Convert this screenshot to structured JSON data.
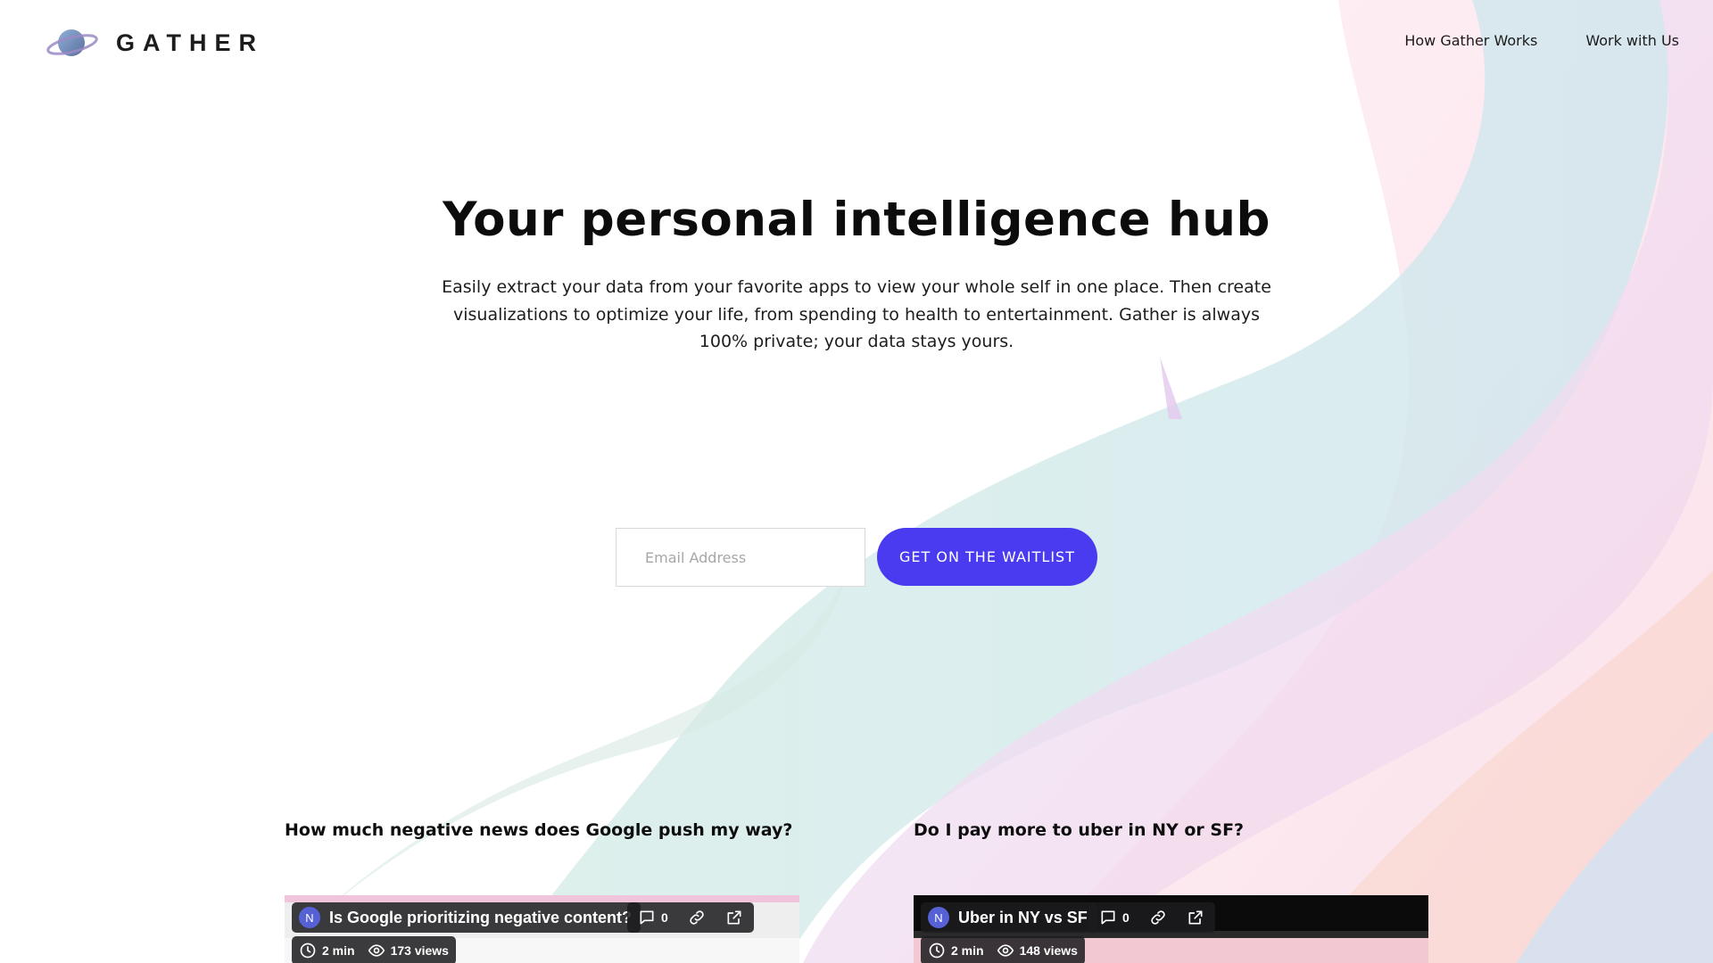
{
  "brand": {
    "name": "GATHER",
    "logo_icon": "planet-icon"
  },
  "nav": {
    "items": [
      "How Gather Works",
      "Work with Us"
    ]
  },
  "hero": {
    "title": "Your personal intelligence hub",
    "description": "Easily extract your data from your favorite apps to view your whole self in one place. Then create visualizations to optimize your life, from spending to health to entertainment. Gather is always 100% private; your data stays yours."
  },
  "signup": {
    "email_placeholder": "Email Address",
    "button_label": "GET ON THE WAITLIST"
  },
  "colors": {
    "accent": "#4a3bf1",
    "text": "#111111"
  },
  "cases": [
    {
      "question": "How much negative news does Google push my way?",
      "video": {
        "avatar": "N",
        "title": "Is Google prioritizing negative content?",
        "comments": "0",
        "duration": "2 min",
        "views": "173 views"
      }
    },
    {
      "question": "Do I pay more to uber in NY or SF?",
      "video": {
        "avatar": "N",
        "title": "Uber in NY vs SF",
        "comments": "0",
        "duration": "2 min",
        "views": "148 views"
      }
    }
  ]
}
